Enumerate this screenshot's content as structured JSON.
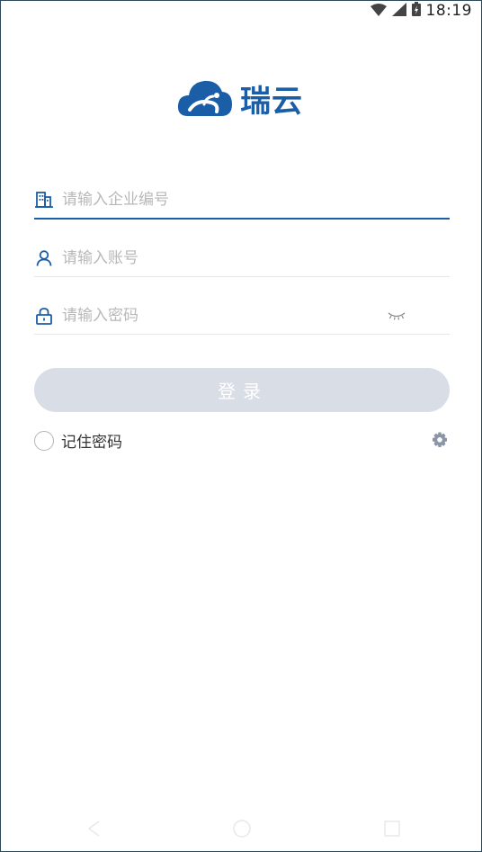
{
  "status_bar": {
    "time": "18:19",
    "icons": [
      "wifi-icon",
      "signal-icon",
      "battery-icon"
    ]
  },
  "logo": {
    "text": "瑞云",
    "icon": "cloud-logo-icon",
    "color": "#1a5ea8"
  },
  "form": {
    "company": {
      "placeholder": "请输入企业编号",
      "value": "",
      "icon": "building-icon"
    },
    "account": {
      "placeholder": "请输入账号",
      "value": "",
      "icon": "user-icon"
    },
    "password": {
      "placeholder": "请输入密码",
      "value": "",
      "icon": "lock-icon",
      "toggle_icon": "eye-closed-icon"
    }
  },
  "login_button": {
    "label": "登录",
    "color": "#d9dde6"
  },
  "remember": {
    "label": "记住密码",
    "checked": false
  },
  "settings": {
    "icon": "gear-icon"
  },
  "nav_bar": {
    "icons": [
      "back-icon",
      "home-icon",
      "recents-icon"
    ]
  }
}
